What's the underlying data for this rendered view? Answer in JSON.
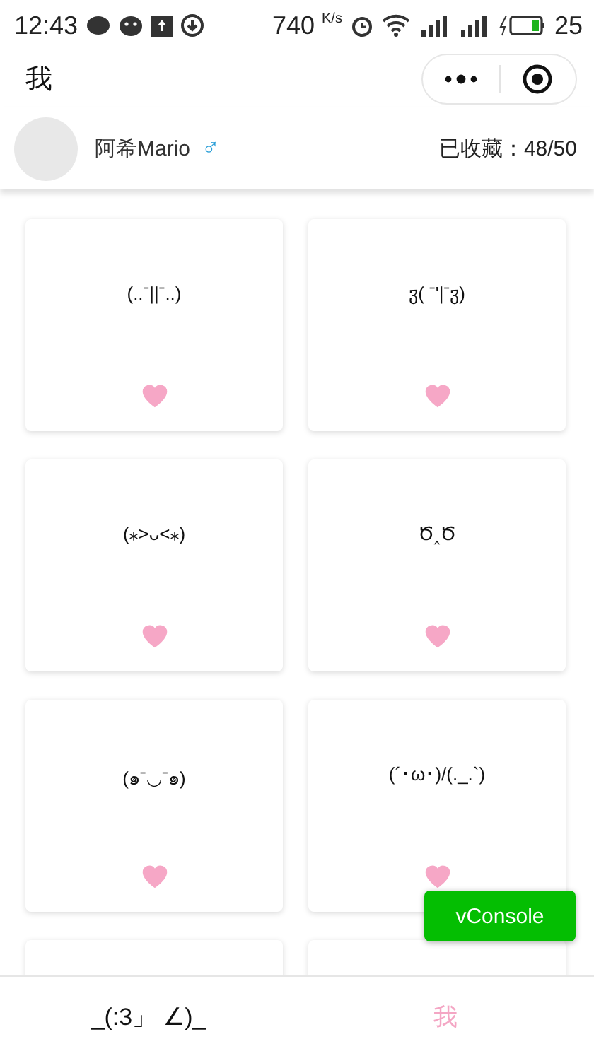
{
  "status_bar": {
    "time": "12:43",
    "speed": "740",
    "speed_unit": "K/s",
    "battery": "25"
  },
  "nav": {
    "title": "我"
  },
  "profile": {
    "name": "阿希Mario",
    "gender": "♂",
    "collected_label": "已收藏：",
    "collected": "48/50"
  },
  "cards": [
    {
      "face": "(..ˉ||ˉ..)",
      "liked": true
    },
    {
      "face": "ჳ( ˉ'|ˉჳ)",
      "liked": true
    },
    {
      "face": "(⁎˃ᴗ˂⁎)",
      "liked": true
    },
    {
      "face": "Ծ‸Ծ",
      "liked": true
    },
    {
      "face": "(๑ˉ◡ˉ๑)",
      "liked": true
    },
    {
      "face": "(´･ω･)/(._.`)",
      "liked": true
    }
  ],
  "vconsole": "vConsole",
  "tabs": [
    {
      "label": "_(:3」 ∠)_",
      "selected": false
    },
    {
      "label": "我",
      "selected": true
    }
  ]
}
